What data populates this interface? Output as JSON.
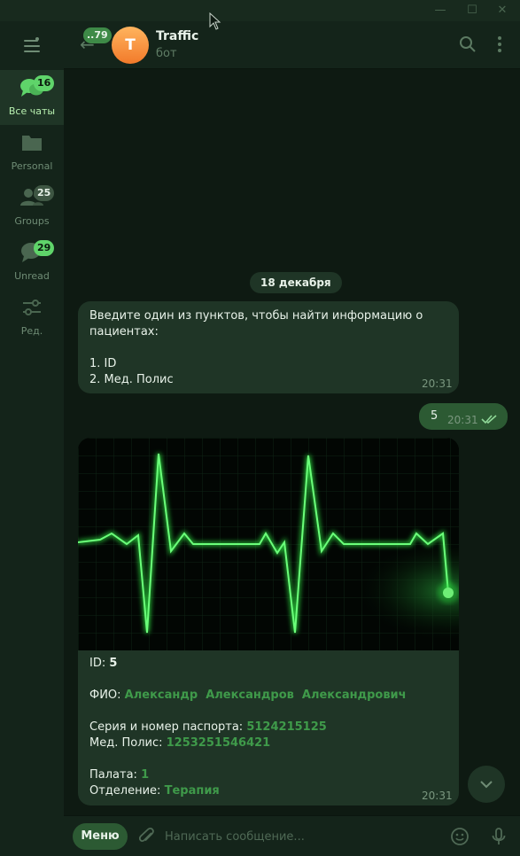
{
  "window": {
    "controls": {
      "minimize": "—",
      "maximize": "☐",
      "close": "✕"
    }
  },
  "sidebar": {
    "folders": [
      {
        "label": "Все чаты",
        "badge": "16",
        "icon": "chats-icon",
        "active": true
      },
      {
        "label": "Personal",
        "badge": "",
        "icon": "folder-icon",
        "active": false
      },
      {
        "label": "Groups",
        "badge": "25",
        "icon": "groups-icon",
        "active": false
      },
      {
        "label": "Unread",
        "badge": "29",
        "icon": "unread-chat-icon",
        "active": false
      },
      {
        "label": "Ред.",
        "badge": "",
        "icon": "edit-sliders-icon",
        "active": false
      }
    ]
  },
  "header": {
    "back_badge": "..79",
    "avatar_letter": "T",
    "title": "Traffic",
    "subtitle": "бот"
  },
  "chat": {
    "date": "18 декабря",
    "messages": [
      {
        "lines": [
          "Введите один из пунктов, чтобы найти информацию о",
          "пациентах:",
          "1. ID",
          "2. Мед. Полис"
        ],
        "time": "20:31"
      },
      {
        "text": "5",
        "time": "20:31"
      },
      {
        "id_label": "ID:",
        "id_value": "5",
        "fio_label": "ФИО:",
        "fio_value": "Александр  Александров  Александрович",
        "passport_label": "Серия и номер паспорта:",
        "passport_value": "5124215125",
        "policy_label": "Мед. Полис:",
        "policy_value": "1253251546421",
        "ward_label": "Палата:",
        "ward_value": "1",
        "dept_label": "Отделение:",
        "dept_value": "Терапия",
        "time": "20:31"
      }
    ]
  },
  "composer": {
    "menu_label": "Меню",
    "placeholder": "Написать сообщение..."
  },
  "colors": {
    "accent": "#5fd46a",
    "bubble_in": "#1f3526",
    "bubble_out": "#2c5a33",
    "background": "#0e1a12"
  }
}
